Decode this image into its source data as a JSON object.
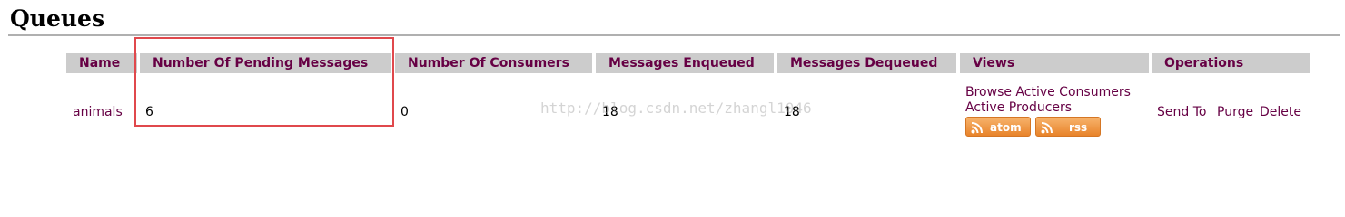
{
  "page": {
    "title": "Queues"
  },
  "table": {
    "headers": {
      "name": "Name",
      "pending": "Number Of Pending Messages",
      "consumers": "Number Of Consumers",
      "enqueued": "Messages Enqueued",
      "dequeued": "Messages Dequeued",
      "views": "Views",
      "operations": "Operations"
    },
    "rows": [
      {
        "name": "animals",
        "pending": "6",
        "consumers": "0",
        "enqueued": "18",
        "dequeued": "18",
        "views": {
          "browse_consumers": "Browse Active Consumers",
          "active_producers": "Active Producers",
          "atom": "atom",
          "rss": "rss"
        },
        "operations": {
          "send_to": "Send To",
          "purge": "Purge",
          "delete": "Delete"
        }
      }
    ]
  },
  "watermark": "http://blog.csdn.net/zhangl1046",
  "colors": {
    "link": "#660044",
    "header_bg": "#cccccc",
    "highlight": "#e0484c",
    "feed": "#f39a45"
  }
}
